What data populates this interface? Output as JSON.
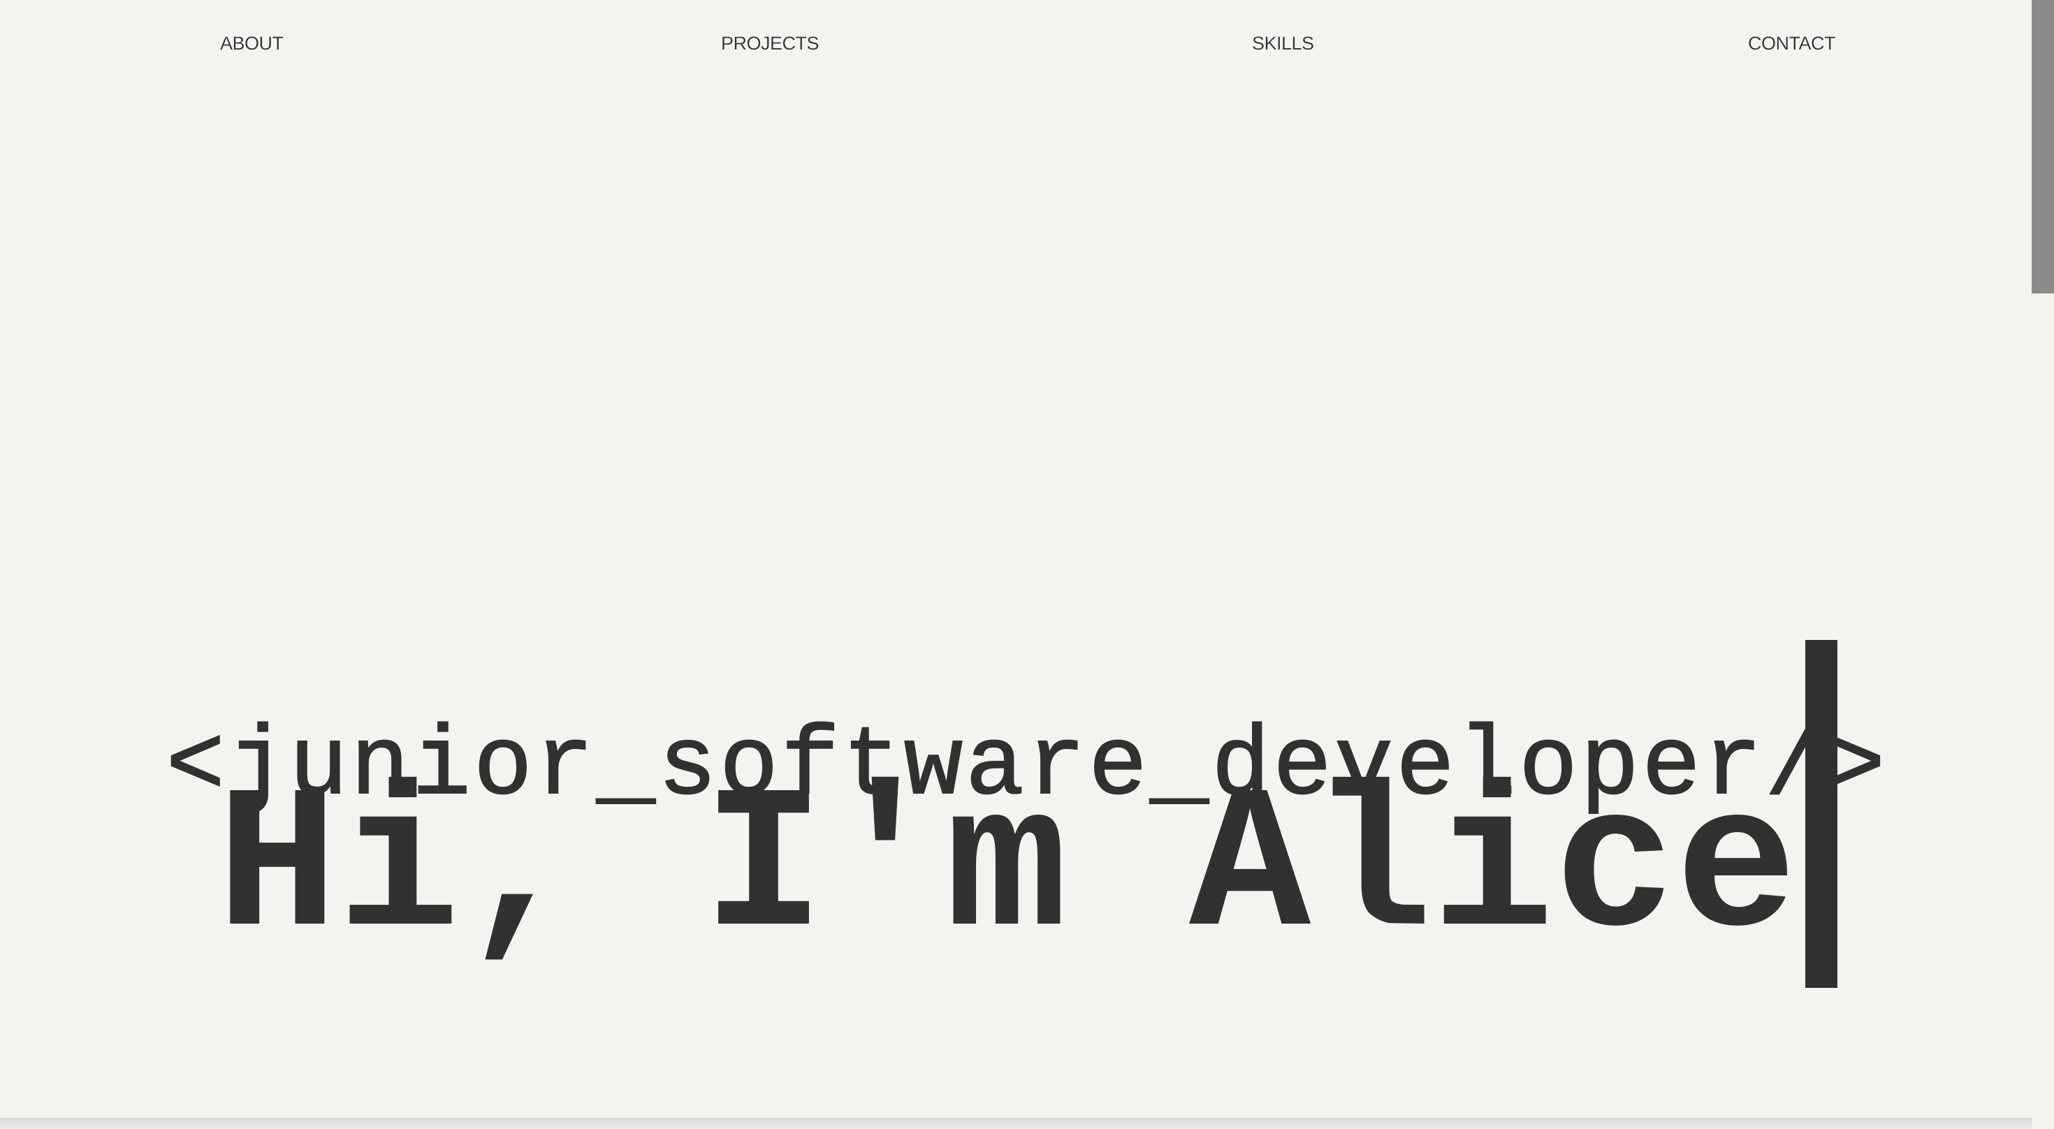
{
  "nav": {
    "items": [
      {
        "label": "ABOUT"
      },
      {
        "label": "PROJECTS"
      },
      {
        "label": "SKILLS"
      },
      {
        "label": "CONTACT"
      }
    ]
  },
  "hero": {
    "title": "Hi, I'm Alice",
    "subtitle": "<junior_software_developer/>"
  },
  "theme": {
    "background": "#f4f3ef",
    "text": "#313131",
    "scrollbar_thumb": "#8a8a8a"
  }
}
